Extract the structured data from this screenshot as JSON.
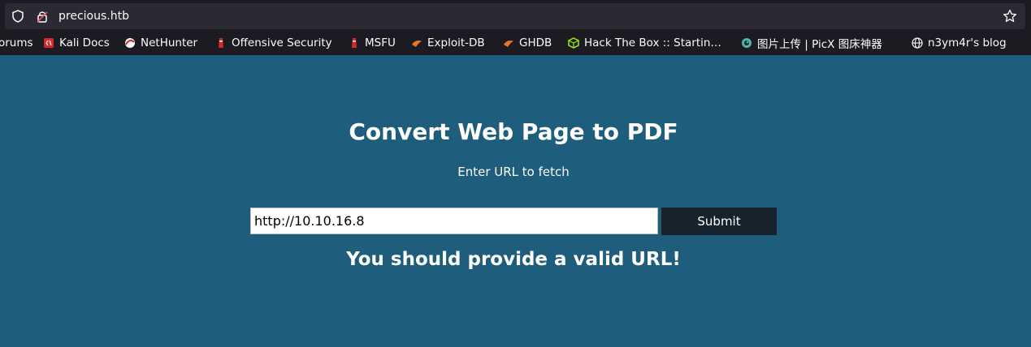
{
  "browser": {
    "url": "precious.htb",
    "bookmarks": [
      {
        "label": "orums",
        "icon": "forums-icon"
      },
      {
        "label": "Kali Docs",
        "icon": "kali-docs-icon"
      },
      {
        "label": "NetHunter",
        "icon": "nethunter-icon"
      },
      {
        "label": "Offensive Security",
        "icon": "offsec-icon"
      },
      {
        "label": "MSFU",
        "icon": "msfu-icon"
      },
      {
        "label": "Exploit-DB",
        "icon": "exploit-db-icon"
      },
      {
        "label": "GHDB",
        "icon": "ghdb-icon"
      },
      {
        "label": "Hack The Box :: Startin…",
        "icon": "hackthebox-icon"
      },
      {
        "label": "图片上传 | PicX 图床神器",
        "icon": "picx-icon"
      },
      {
        "label": "n3ym4r's blog",
        "icon": "globe-icon"
      }
    ]
  },
  "page": {
    "title": "Convert Web Page to PDF",
    "subtitle": "Enter URL to fetch",
    "url_input_value": "http://10.10.16.8",
    "submit_label": "Submit",
    "error_message": "You should provide a valid URL!"
  },
  "colors": {
    "chrome_bg": "#1c1b22",
    "page_bg": "#1e5d7c",
    "button_bg": "#16232c"
  }
}
